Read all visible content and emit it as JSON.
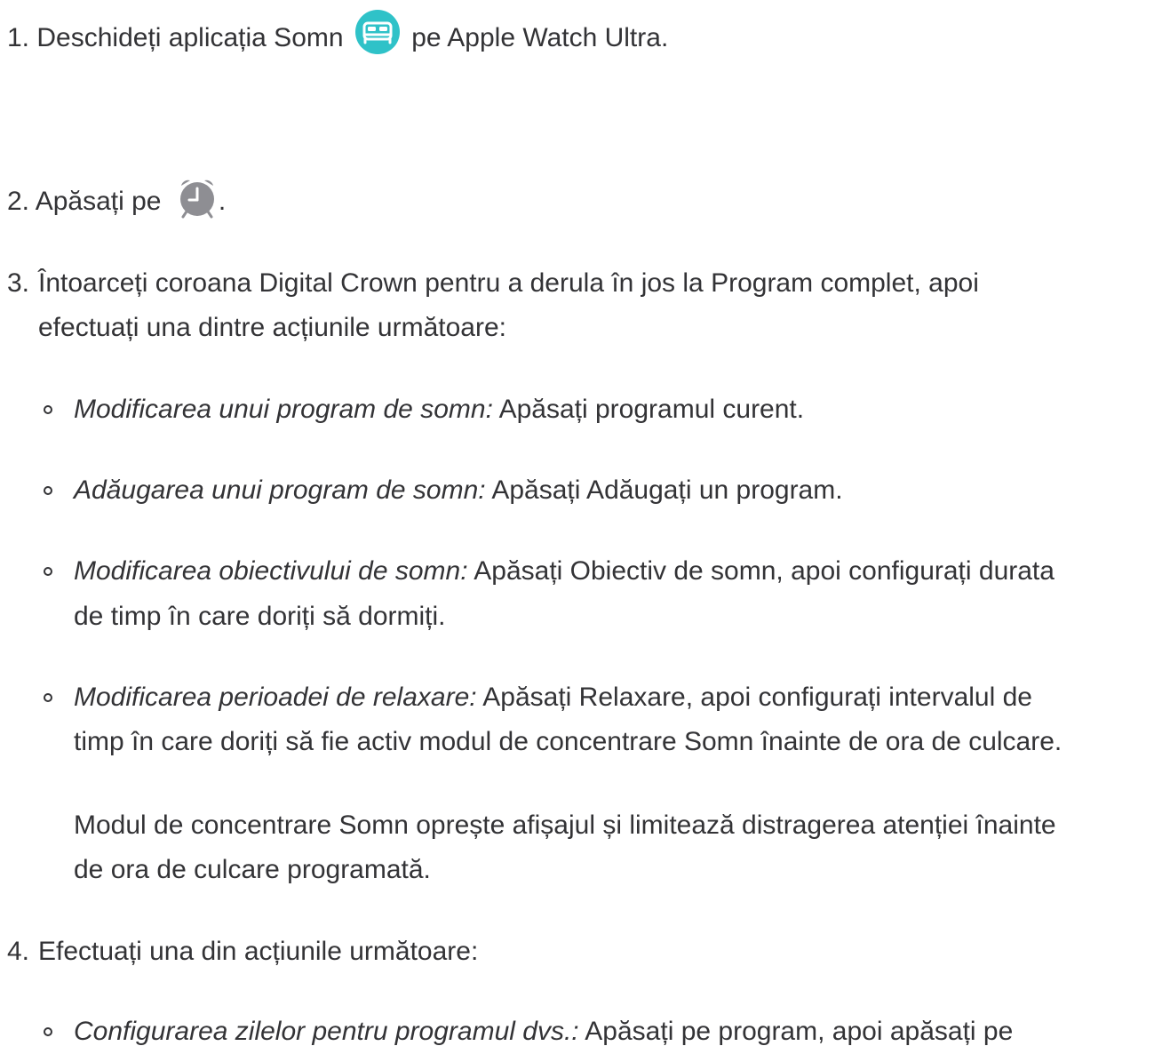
{
  "steps": [
    {
      "number": "1.",
      "text_before_icon": "Deschideți aplicația Somn",
      "icon": "bed-icon",
      "text_after_icon": "pe Apple Watch Ultra."
    },
    {
      "number": "2.",
      "text_before_icon": "Apăsați pe",
      "icon": "alarm-clock-icon",
      "text_after_icon": "."
    },
    {
      "number": "3.",
      "lines": [
        "Întoarceți coroana Digital Crown pentru a derula în jos la Program complet, apoi",
        "efectuați una dintre acțiunile următoare:"
      ],
      "bullets": [
        {
          "label": "Modificarea unui program de somn:",
          "lines": [
            "Apăsați programul curent."
          ]
        },
        {
          "label": "Adăugarea unui program de somn:",
          "lines": [
            "Apăsați Adăugați un program."
          ]
        },
        {
          "label": "Modificarea obiectivului de somn:",
          "lines": [
            "Apăsați Obiectiv de somn, apoi configurați durata",
            "de timp în care doriți să dormiți."
          ]
        },
        {
          "label": "Modificarea perioadei de relaxare:",
          "lines": [
            "Apăsați Relaxare, apoi configurați intervalul de",
            "timp în care doriți să fie activ modul de concentrare Somn înainte de ora de culcare."
          ],
          "note_lines": [
            "Modul de concentrare Somn oprește afișajul și limitează distragerea atenției înainte",
            "de ora de culcare programată."
          ]
        }
      ]
    },
    {
      "number": "4.",
      "lines": [
        "Efectuați una din acțiunile următoare:"
      ],
      "bullets": [
        {
          "label": "Configurarea zilelor pentru programul dvs.:",
          "lines": [
            "Apăsați pe program, apoi apăsați pe"
          ]
        }
      ]
    }
  ],
  "colors": {
    "text": "#333336",
    "somn_icon": "#2fc2c8",
    "alarm_icon": "#8e8e93"
  }
}
